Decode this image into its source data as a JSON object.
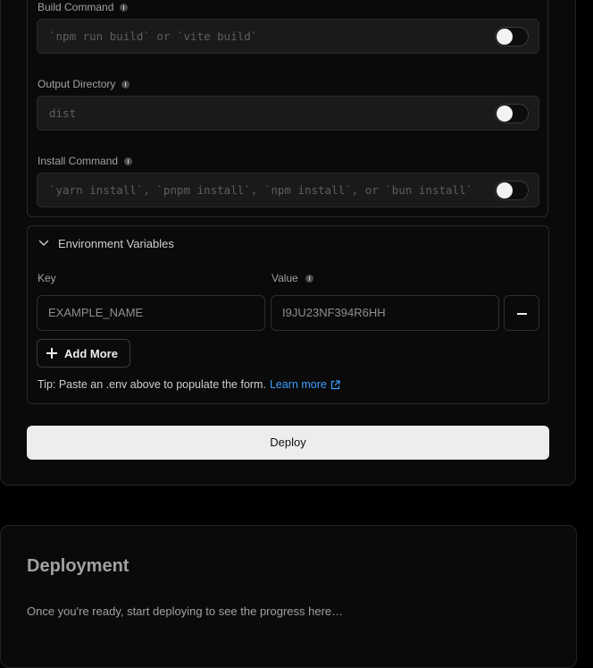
{
  "build": {
    "fields": [
      {
        "label": "Build Command",
        "placeholder": "`npm run build` or `vite build`"
      },
      {
        "label": "Output Directory",
        "placeholder": "dist"
      },
      {
        "label": "Install Command",
        "placeholder": "`yarn install`, `pnpm install`, `npm install`, or `bun install`"
      }
    ]
  },
  "env": {
    "title": "Environment Variables",
    "key_label": "Key",
    "value_label": "Value",
    "key_placeholder": "EXAMPLE_NAME",
    "value_placeholder": "I9JU23NF394R6HH",
    "add_more_label": "Add More",
    "tip_text": "Tip: Paste an .env above to populate the form.",
    "learn_more_label": "Learn more"
  },
  "deploy_button_label": "Deploy",
  "deployment": {
    "title": "Deployment",
    "description": "Once you're ready, start deploying to see the progress here…"
  },
  "colors": {
    "link": "#3b9eff",
    "button_bg": "#ededed",
    "card_bg": "#0a0a0a"
  }
}
